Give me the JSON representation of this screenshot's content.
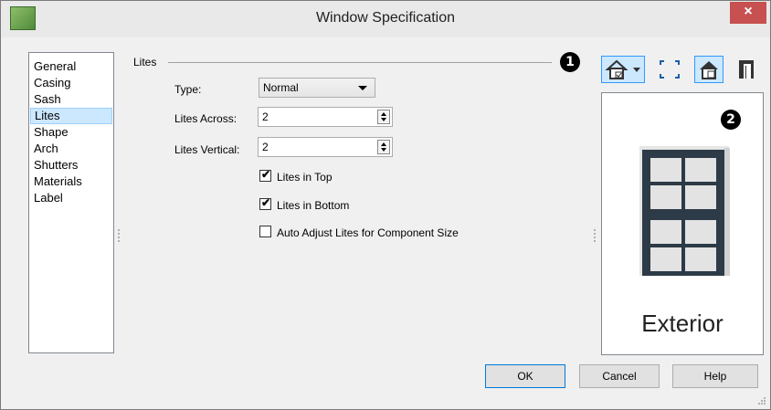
{
  "window": {
    "title": "Window Specification",
    "close_glyph": "×"
  },
  "sidebar": {
    "items": [
      {
        "label": "General"
      },
      {
        "label": "Casing"
      },
      {
        "label": "Sash"
      },
      {
        "label": "Lites",
        "selected": true
      },
      {
        "label": "Shape"
      },
      {
        "label": "Arch"
      },
      {
        "label": "Shutters"
      },
      {
        "label": "Materials"
      },
      {
        "label": "Label"
      }
    ]
  },
  "lites": {
    "group_label": "Lites",
    "callout_1": "1",
    "type_label": "Type:",
    "type_value": "Normal",
    "across_label": "Lites Across:",
    "across_value": "2",
    "vertical_label": "Lites Vertical:",
    "vertical_value": "2",
    "lites_in_top": {
      "label": "Lites in Top",
      "checked": true
    },
    "lites_in_bottom": {
      "label": "Lites in Bottom",
      "checked": true
    },
    "auto_adjust": {
      "label": "Auto Adjust Lites for Component Size",
      "checked": false
    }
  },
  "preview": {
    "callout_2": "2",
    "caption": "Exterior"
  },
  "buttons": {
    "ok": "OK",
    "cancel": "Cancel",
    "help": "Help"
  },
  "colors": {
    "accent": "#0078d7",
    "close": "#c75050",
    "selection": "#cce8ff",
    "frame": "#2d3a47"
  },
  "icons": [
    "view-direction-icon",
    "fill-window-icon",
    "color-preview-icon",
    "wall-opening-icon",
    "size-grip-icon"
  ]
}
